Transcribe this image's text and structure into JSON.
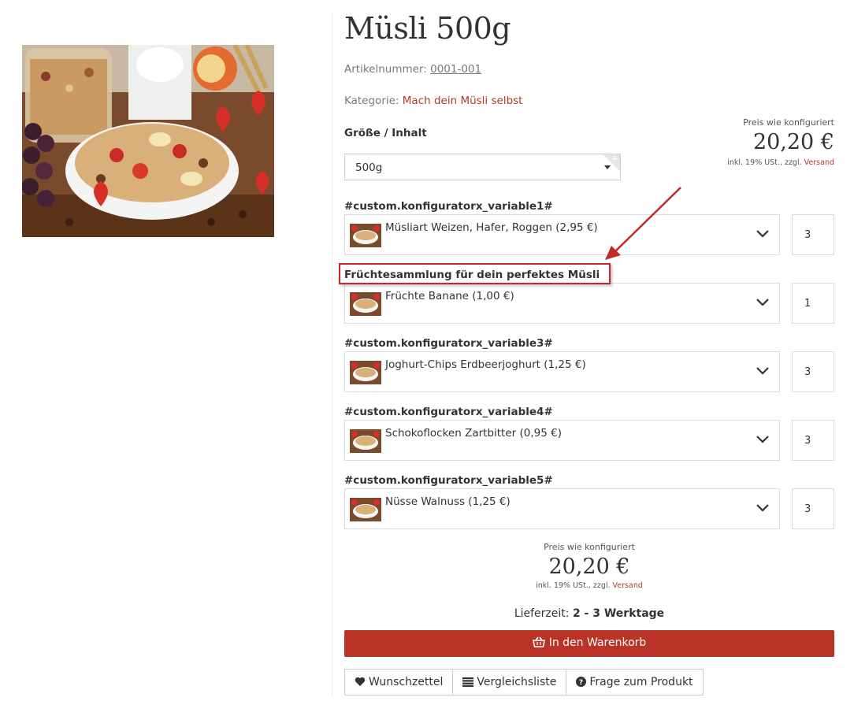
{
  "product": {
    "title": "Müsli 500g",
    "sku_label": "Artikelnummer:",
    "sku_value": "0001-001",
    "category_label": "Kategorie:",
    "category_value": "Mach dein Müsli selbst"
  },
  "size": {
    "label": "Größe / Inhalt",
    "selected": "500g"
  },
  "price": {
    "caption": "Preis wie konfiguriert",
    "amount": "20,20 €",
    "tax_text": "inkl. 19% USt., zzgl.",
    "shipping_link": "Versand"
  },
  "options": [
    {
      "label": "#custom.konfiguratorx_variable1#",
      "selected": "Müsliart Weizen, Hafer, Roggen (2,95 €)",
      "qty": "3"
    },
    {
      "label": "Früchtesammlung für dein perfektes Müsli",
      "selected": "Früchte Banane (1,00 €)",
      "qty": "1"
    },
    {
      "label": "#custom.konfiguratorx_variable3#",
      "selected": "Joghurt-Chips Erdbeerjoghurt (1,25 €)",
      "qty": "3"
    },
    {
      "label": "#custom.konfiguratorx_variable4#",
      "selected": "Schokoflocken Zartbitter (0,95 €)",
      "qty": "3"
    },
    {
      "label": "#custom.konfiguratorx_variable5#",
      "selected": "Nüsse Walnuss (1,25 €)",
      "qty": "3"
    }
  ],
  "delivery": {
    "label": "Lieferzeit:",
    "value": "2 - 3 Werktage"
  },
  "actions": {
    "cart": "In den Warenkorb",
    "wishlist": "Wunschzettel",
    "compare": "Vergleichsliste",
    "question": "Frage zum Produkt"
  },
  "icons": {
    "cart": "basket-icon",
    "wishlist": "heart-icon",
    "compare": "list-icon",
    "question": "question-circle-icon",
    "dropdown": "chevron-down-icon"
  },
  "colors": {
    "accent": "#b93426",
    "link": "#b43a26",
    "annotation": "#c0282a"
  }
}
